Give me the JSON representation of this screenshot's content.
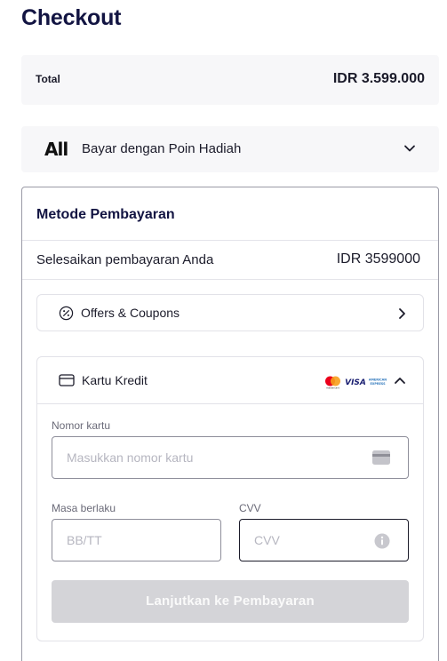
{
  "page": {
    "title": "Checkout"
  },
  "total": {
    "label": "Total",
    "value": "IDR 3.599.000"
  },
  "points": {
    "logo": "All",
    "label": "Bayar dengan Poin Hadiah",
    "icons": {
      "expand": "chevron-down-icon"
    }
  },
  "payment": {
    "heading": "Metode Pembayaran",
    "finish_label": "Selesaikan pembayaran Anda",
    "finish_value": "IDR 3599000",
    "offers": {
      "label": "Offers & Coupons",
      "icons": {
        "leading": "discount-percent-icon",
        "trailing": "chevron-right-icon"
      }
    },
    "credit_card": {
      "label": "Kartu Kredit",
      "icons": {
        "leading": "credit-card-icon",
        "collapse": "chevron-up-icon"
      },
      "logos": [
        "mastercard-logo",
        "visa-logo",
        "amex-logo"
      ],
      "logo_text": {
        "visa": "VISA",
        "amex_top": "AMERICAN",
        "amex_bottom": "EXPRESS",
        "mastercard": "mastercard"
      },
      "card_number": {
        "label": "Nomor kartu",
        "placeholder": "Masukkan nomor kartu"
      },
      "expiry": {
        "label": "Masa berlaku",
        "placeholder": "BB/TT"
      },
      "cvv": {
        "label": "CVV",
        "placeholder": "CVV"
      },
      "submit_label": "Lanjutkan ke Pembayaran"
    }
  },
  "colors": {
    "title": "#121442",
    "panel_bg": "#f7f7f9",
    "button_disabled": "#d4d4d8",
    "mastercard_red": "#eb001b",
    "mastercard_orange": "#f79e1b",
    "visa_blue": "#1a1f71",
    "amex_blue": "#2e77bc"
  }
}
